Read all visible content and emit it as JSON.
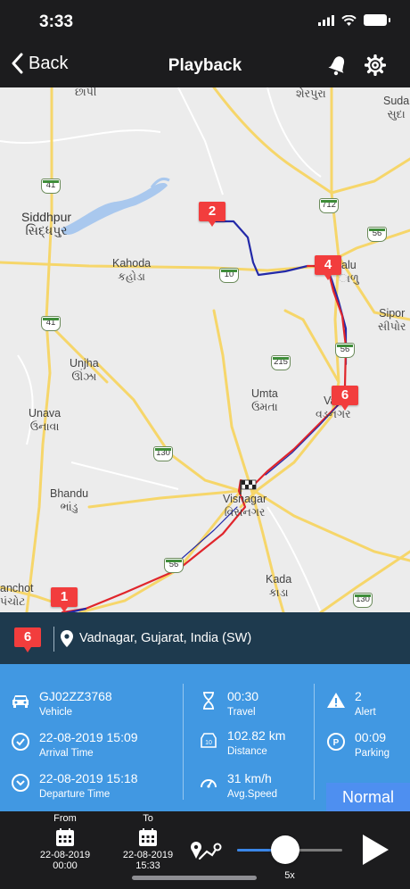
{
  "status": {
    "time": "3:33"
  },
  "nav": {
    "back_label": "Back",
    "title": "Playback"
  },
  "map": {
    "places": {
      "chhapi": "છાપી",
      "sherpura": "શેરપુરા",
      "suda1": "Suda",
      "suda2": "સુદા",
      "siddhpur_en": "Siddhpur",
      "siddhpur_gu": "સિદ્ધપુર",
      "kahoda_en": "Kahoda",
      "kahoda_gu": "કહોડા",
      "lalu_en": "alu",
      "lalu_gu": "ાળુ",
      "sipor_en": "Sipor",
      "sipor_gu": "સીપોર",
      "unjha_en": "Unjha",
      "unjha_gu": "ઊંઝા",
      "umta_en": "Umta",
      "umta_gu": "ઉમતા",
      "vad_en": "Vad",
      "vad_gu": "વડનગર",
      "unava_en": "Unava",
      "unava_gu": "ઉનાવા",
      "bhandu_en": "Bhandu",
      "bhandu_gu": "ભાંડુ",
      "visnagar_en": "Visnagar",
      "visnagar_gu": "વિસનગર",
      "kada_en": "Kada",
      "kada_gu": "કાડા",
      "anchot_en": "anchot",
      "anchot_gu": "પંચોટ"
    },
    "shields": {
      "s41a": "41",
      "s712": "712",
      "s56a": "56",
      "s10": "10",
      "s41b": "41",
      "s56b": "56",
      "s215": "215",
      "s130a": "130",
      "s56c": "56",
      "s130b": "130"
    },
    "markers": {
      "m1": "1",
      "m2": "2",
      "m4": "4",
      "m6": "6"
    },
    "route_colors": {
      "moving": "#e0252b",
      "idle": "#2329a8"
    }
  },
  "location": {
    "marker": "6",
    "address": "Vadnagar, Gujarat, India (SW)"
  },
  "info": {
    "vehicle": {
      "value": "GJ02ZZ3768",
      "label": "Vehicle"
    },
    "arrival": {
      "value": "22-08-2019 15:09",
      "label": "Arrival Time"
    },
    "departure": {
      "value": "22-08-2019 15:18",
      "label": "Departure Time"
    },
    "travel": {
      "value": "00:30",
      "label": "Travel"
    },
    "distance": {
      "value": "102.82 km",
      "label": "Distance"
    },
    "speed": {
      "value": "31 km/h",
      "label": "Avg.Speed"
    },
    "alert": {
      "value": "2",
      "label": "Alert"
    },
    "parking": {
      "value": "00:09",
      "label": "Parking"
    },
    "mode_button": "Normal"
  },
  "controls": {
    "from": {
      "label": "From",
      "date": "22-08-2019",
      "time": "00:00"
    },
    "to": {
      "label": "To",
      "date": "22-08-2019",
      "time": "15:33"
    },
    "speed_label": "5x",
    "speed_position": 0.46
  }
}
